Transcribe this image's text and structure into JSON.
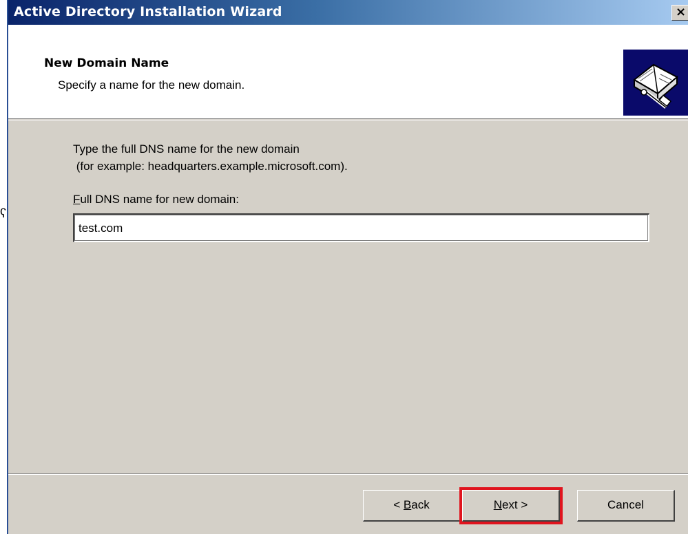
{
  "window": {
    "title": "Active Directory Installation Wizard",
    "close_glyph": "×"
  },
  "header": {
    "title": "New Domain Name",
    "subtitle": "Specify a name for the new domain.",
    "icon": "book-network-wizard-icon"
  },
  "body": {
    "intro_line1": "Type the full DNS name for the new domain",
    "intro_line2": " (for example: headquarters.example.microsoft.com).",
    "field_label_prefix": "F",
    "field_label_rest": "ull DNS name for new domain:",
    "dns_input_value": "test.com"
  },
  "buttons": {
    "back_prefix": "< ",
    "back_accel": "B",
    "back_rest": "ack",
    "next_accel": "N",
    "next_rest": "ext >",
    "cancel": "Cancel"
  },
  "highlight_color": "#e0141e",
  "left_strip_glyph": "ʕ"
}
